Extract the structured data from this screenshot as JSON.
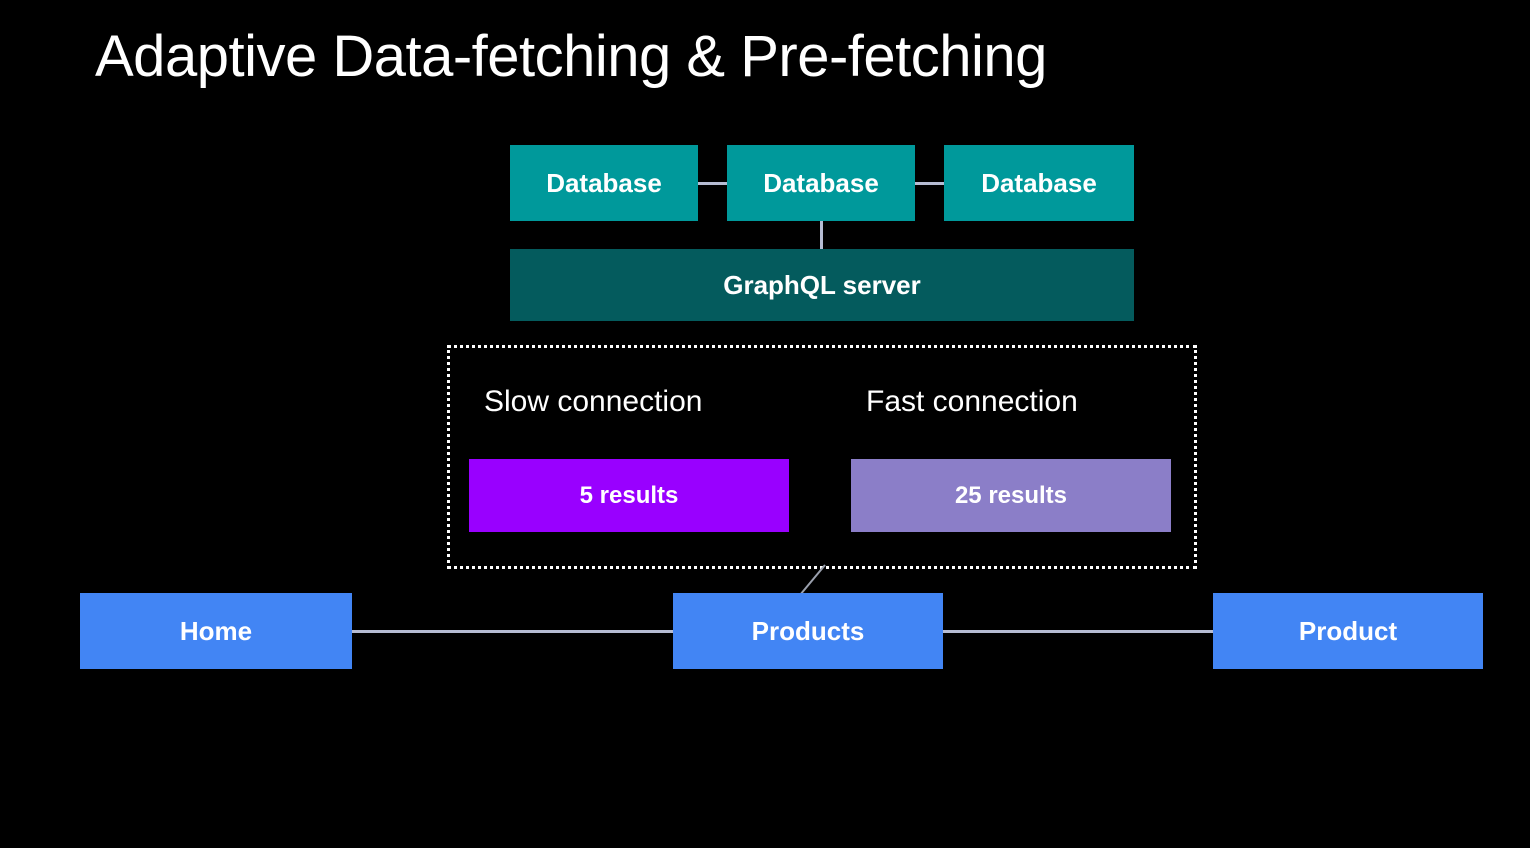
{
  "slide": {
    "title": "Adaptive Data-fetching & Pre-fetching",
    "background_color": "#000000"
  },
  "colors": {
    "database": "#00999b",
    "graphql_server": "#045b5d",
    "slow_results": "#9900ff",
    "fast_results": "#8b7ec8",
    "route": "#4285f4",
    "connector": "#b6bcd3",
    "text": "#ffffff"
  },
  "data_layer": {
    "databases": [
      {
        "label": "Database"
      },
      {
        "label": "Database"
      },
      {
        "label": "Database"
      }
    ],
    "server": {
      "label": "GraphQL server"
    }
  },
  "adaptive_panel": {
    "columns": [
      {
        "title": "Slow connection",
        "results_label": "5 results",
        "results_count": 5
      },
      {
        "title": "Fast connection",
        "results_label": "25 results",
        "results_count": 25
      }
    ]
  },
  "routes": [
    {
      "label": "Home"
    },
    {
      "label": "Products"
    },
    {
      "label": "Product"
    }
  ]
}
